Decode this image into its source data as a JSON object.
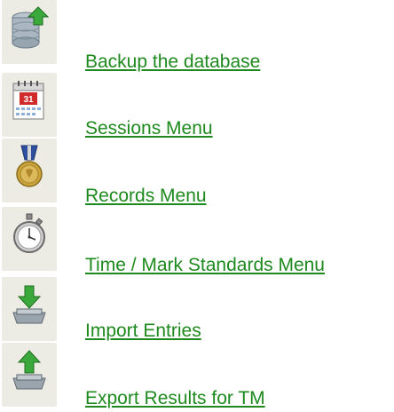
{
  "menu": {
    "items": [
      {
        "label": "Backup the database",
        "icon": "database-upload-icon"
      },
      {
        "label": "Sessions Menu",
        "icon": "calendar-icon"
      },
      {
        "label": "Records Menu",
        "icon": "medal-icon"
      },
      {
        "label": "Time / Mark Standards Menu",
        "icon": "stopwatch-icon"
      },
      {
        "label": "Import Entries",
        "icon": "import-tray-icon"
      },
      {
        "label": "Export Results for TM",
        "icon": "export-tray-icon"
      }
    ],
    "colors": {
      "link": "#1e8a1e",
      "icon_tile": "#ecebe4",
      "arrow_green": "#3aa83a",
      "calendar_red": "#d02a2a",
      "medal_gold": "#c9a23a",
      "ribbon_blue": "#2f4f9f"
    }
  }
}
